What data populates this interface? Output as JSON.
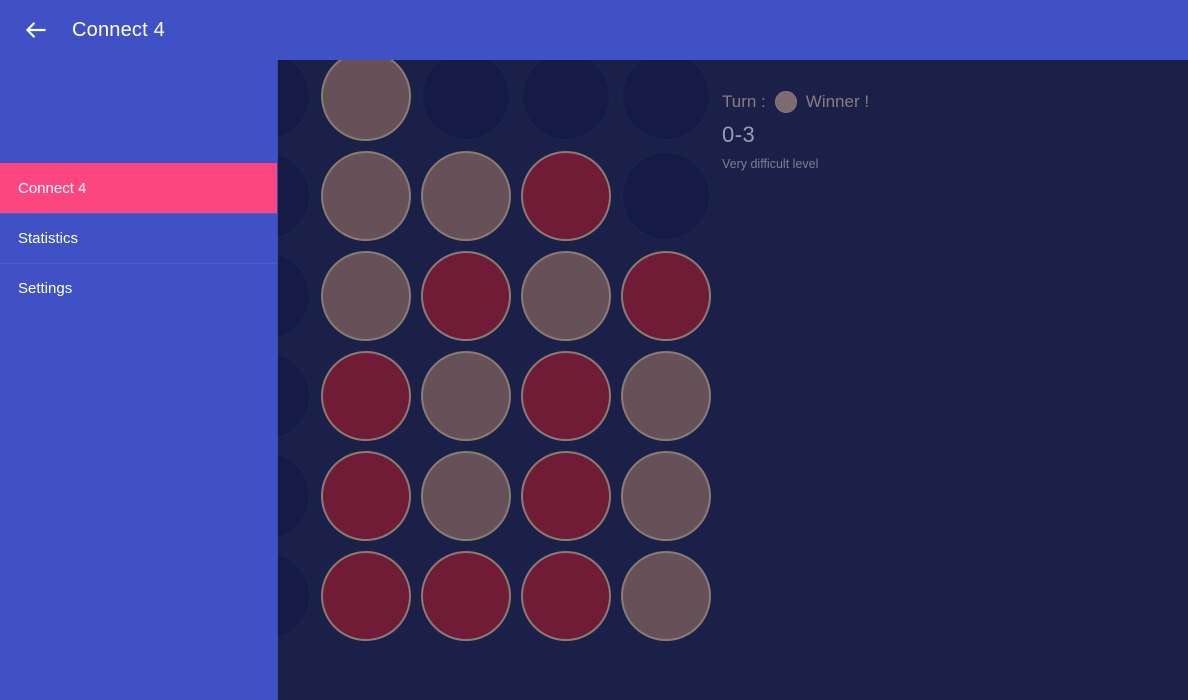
{
  "appbar": {
    "back_icon": "arrow-left-icon",
    "title": "Connect 4"
  },
  "drawer": {
    "items": [
      {
        "label": "Connect 4",
        "selected": true
      },
      {
        "label": "Statistics",
        "selected": false
      },
      {
        "label": "Settings",
        "selected": false
      }
    ]
  },
  "status": {
    "turn_label": "Turn :",
    "turn_disc_color": "#7d6b70",
    "winner_label": "Winner !",
    "score": "0-3",
    "level": "Very difficult level"
  },
  "colors": {
    "accent_pink": "#fb4681",
    "primary_blue": "#3f51c4",
    "board_bg": "#1a2047",
    "empty_cell": "#151b44",
    "disc_red": "#701c36",
    "disc_tan": "#655157",
    "disc_border": "#8b7b76"
  },
  "board": {
    "rows": 6,
    "cols": 5,
    "legend": {
      "e": "empty",
      "r": "red",
      "t": "tan"
    },
    "cells": [
      [
        "e",
        "t",
        "e",
        "e",
        "e"
      ],
      [
        "e",
        "t",
        "t",
        "r",
        "e"
      ],
      [
        "e",
        "t",
        "r",
        "t",
        "r"
      ],
      [
        "e",
        "r",
        "t",
        "r",
        "t"
      ],
      [
        "e",
        "r",
        "t",
        "r",
        "t"
      ],
      [
        "e",
        "r",
        "r",
        "r",
        "t"
      ]
    ]
  }
}
